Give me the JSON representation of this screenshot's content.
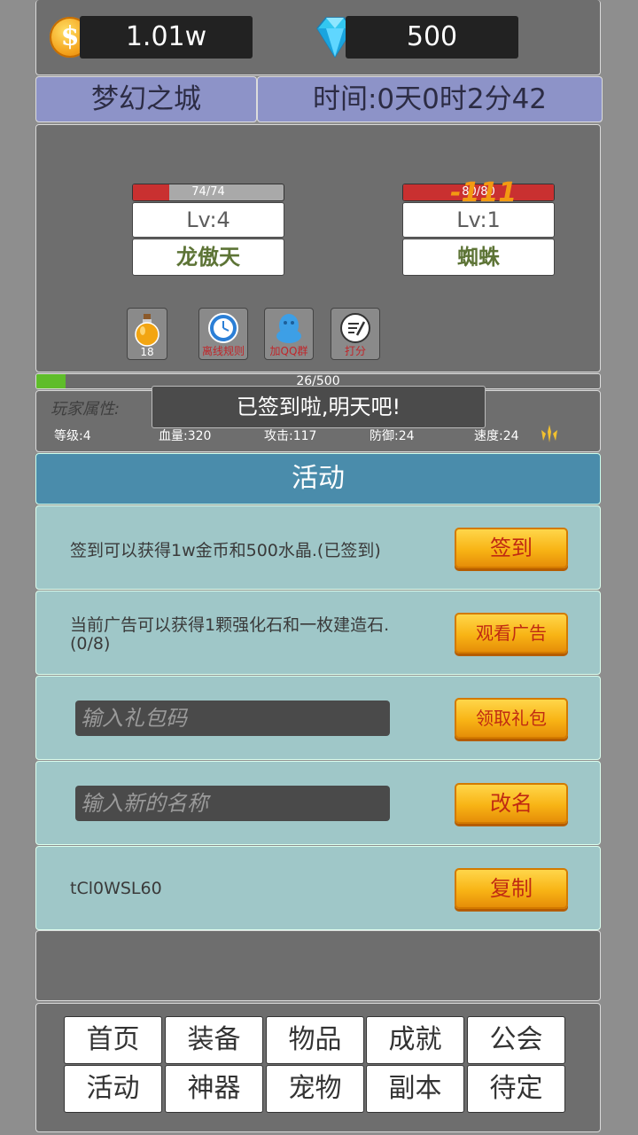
{
  "currency": {
    "gold": "1.01w",
    "gems": "500",
    "gold_icon_glyph": "$"
  },
  "header": {
    "city": "梦幻之城",
    "time": "时间:0天0时2分42"
  },
  "battle": {
    "player": {
      "hp_text": "74/74",
      "hp_fraction": 0.24,
      "level": "Lv:4",
      "name": "龙傲天"
    },
    "enemy": {
      "hp_text": "80/80",
      "hp_fraction": 1.0,
      "level": "Lv:1",
      "name": "蜘蛛"
    },
    "damage_popup": "-111",
    "tools": [
      {
        "icon": "potion-icon",
        "label": "18"
      },
      {
        "icon": "clock-icon",
        "label": "离线规则"
      },
      {
        "icon": "qq-icon",
        "label": "加QQ群"
      },
      {
        "icon": "rate-icon",
        "label": "打分"
      }
    ]
  },
  "exp": {
    "text": "26/500",
    "fraction": 0.052
  },
  "attributes": {
    "title": "玩家属性:",
    "level": "等级:4",
    "hp": "血量:320",
    "attack": "攻击:117",
    "defense": "防御:24",
    "speed": "速度:24"
  },
  "toast": "已签到啦,明天吧!",
  "activity": {
    "title": "活动",
    "signin": {
      "text": "签到可以获得1w金币和500水晶.(已签到)",
      "button": "签到"
    },
    "ad": {
      "text_line1": "当前广告可以获得1颗强化石和一枚建造石.",
      "text_line2": "(0/8)",
      "button": "观看广告"
    },
    "gift": {
      "placeholder": "输入礼包码",
      "button": "领取礼包"
    },
    "rename": {
      "placeholder": "输入新的名称",
      "button": "改名"
    },
    "copy": {
      "code": "tCl0WSL60",
      "button": "复制"
    }
  },
  "nav": {
    "row1": [
      "首页",
      "装备",
      "物品",
      "成就",
      "公会"
    ],
    "row2": [
      "活动",
      "神器",
      "宠物",
      "副本",
      "待定"
    ]
  },
  "colors": {
    "accent_header": "#4a8cab",
    "title_bg": "#8d93c8",
    "row_bg": "#9fc7c8",
    "button_gold": "#f8b415",
    "hp_red": "#c93030",
    "exp_green": "#5fbd2a"
  }
}
